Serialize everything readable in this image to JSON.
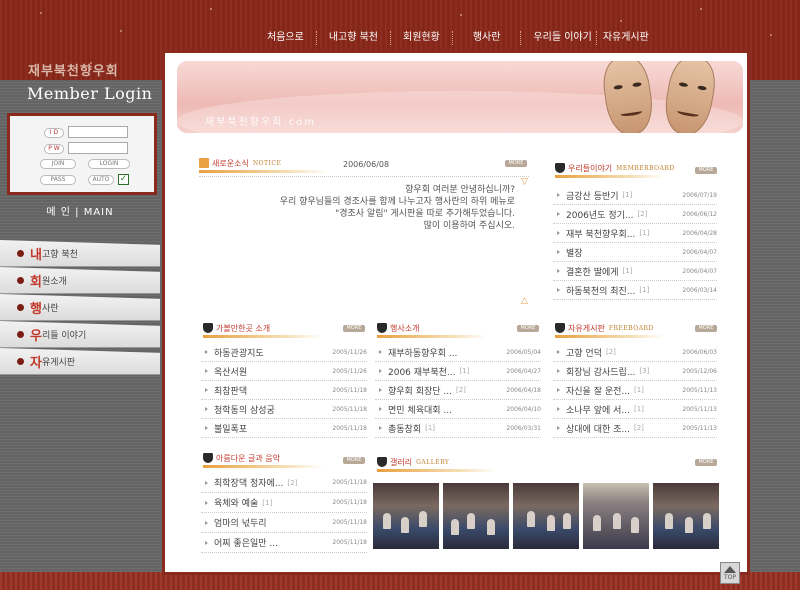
{
  "nav": [
    "처음으로",
    "내고향 북천",
    "회원현황",
    "행사란",
    "우리들 이야기",
    "자유게시판"
  ],
  "logo": "재부북천향우회",
  "member_login": {
    "title": "Member Login",
    "id_label": "I D",
    "pw_label": "P W",
    "join": "JOIN",
    "login": "LOGIN",
    "pass": "PASS",
    "auto": "AUTO",
    "auto_checked": "✓"
  },
  "main_link": "메 인 | MAIN",
  "side_menu": [
    {
      "big": "내",
      "rest": "고향 북천"
    },
    {
      "big": "회",
      "rest": "원소개"
    },
    {
      "big": "행",
      "rest": "사란"
    },
    {
      "big": "우",
      "rest": "리들 이야기"
    },
    {
      "big": "자",
      "rest": "유게시판"
    }
  ],
  "banner": {
    "site": "재부북천향우회.com"
  },
  "notice": {
    "title": "새로운소식",
    "title_en": "NOTICE",
    "date": "2006/06/08",
    "more": "MORE",
    "lines": [
      "향우회 여러분 안녕하십니까?",
      "우리 향우님들의 경조사를 함께 나누고자 행사란의 하위 메뉴로",
      "\"경조사 알림\" 게시판을 따로 추가해두었습니다.",
      "많이 이용하여 주십시오."
    ]
  },
  "member_board": {
    "title": "우리들이야기",
    "title_en": "MEMBERBOARD",
    "more": "MORE",
    "items": [
      {
        "text": "금강산 등반기",
        "count": "[1]",
        "date": "2006/07/19"
      },
      {
        "text": "2006년도 정기...",
        "count": "[2]",
        "date": "2006/06/12"
      },
      {
        "text": "재부 북천향우회...",
        "count": "[1]",
        "date": "2006/04/28"
      },
      {
        "text": "별장",
        "count": "",
        "date": "2006/04/07"
      },
      {
        "text": "결혼한 딸에게",
        "count": "[1]",
        "date": "2006/04/07"
      },
      {
        "text": "하동북천의 최진...",
        "count": "[1]",
        "date": "2006/03/14"
      }
    ]
  },
  "intro": {
    "title": "가볼만한곳 소개",
    "more": "MORE",
    "items": [
      {
        "text": "하동관광지도",
        "count": "",
        "date": "2005/11/26"
      },
      {
        "text": "옥산서원",
        "count": "",
        "date": "2005/11/26"
      },
      {
        "text": "최참판댁",
        "count": "",
        "date": "2005/11/18"
      },
      {
        "text": "청학동의 삼성궁",
        "count": "",
        "date": "2005/11/18"
      },
      {
        "text": "불일폭포",
        "count": "",
        "date": "2005/11/18"
      }
    ]
  },
  "events": {
    "title": "행사소개",
    "more": "MORE",
    "items": [
      {
        "text": "재부하동향우회 ...",
        "count": "",
        "date": "2006/05/04"
      },
      {
        "text": "2006 재부북천...",
        "count": "[1]",
        "date": "2006/04/27"
      },
      {
        "text": "향우회 회장단 ...",
        "count": "[2]",
        "date": "2006/04/18"
      },
      {
        "text": "면민 체육대회 ...",
        "count": "",
        "date": "2006/04/10"
      },
      {
        "text": "총동창회",
        "count": "[1]",
        "date": "2006/03/31"
      }
    ]
  },
  "free_board": {
    "title": "자유게시판",
    "title_en": "FREEBOARD",
    "more": "MORE",
    "items": [
      {
        "text": "고향 언덕",
        "count": "[2]",
        "date": "2006/06/03"
      },
      {
        "text": "회장님 감사드립...",
        "count": "[3]",
        "date": "2005/12/06"
      },
      {
        "text": "자신을 잘 운전...",
        "count": "[1]",
        "date": "2005/11/13"
      },
      {
        "text": "소나무 앞에 서...",
        "count": "[1]",
        "date": "2005/11/13"
      },
      {
        "text": "상대에 대한 조...",
        "count": "[2]",
        "date": "2005/11/13"
      }
    ]
  },
  "writings": {
    "title": "아름다운 글과 음악",
    "more": "MORE",
    "items": [
      {
        "text": "최학장댁 정자에...",
        "count": "[2]",
        "date": "2005/11/18"
      },
      {
        "text": "육체와 예술",
        "count": "[1]",
        "date": "2005/11/18"
      },
      {
        "text": "엄마의 넋두리",
        "count": "",
        "date": "2005/11/18"
      },
      {
        "text": "어찌 좋은일만 ...",
        "count": "",
        "date": "2005/11/18"
      }
    ]
  },
  "gallery": {
    "title": "갤러리",
    "title_en": "GALLERY",
    "more": "MORE",
    "thumbs": [
      "gallery-photo-1",
      "gallery-photo-2",
      "gallery-photo-3",
      "gallery-photo-4",
      "gallery-photo-5"
    ]
  },
  "top_button": "TOP"
}
